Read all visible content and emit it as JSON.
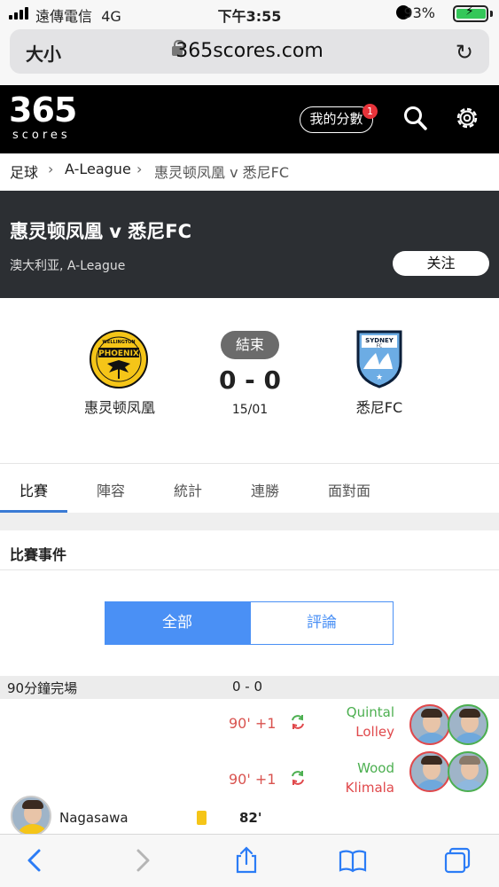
{
  "status_bar": {
    "carrier": "遠傳電信",
    "network": "4G",
    "time": "下午3:55",
    "battery": "93%"
  },
  "browser": {
    "text_size": "大小",
    "url": "365scores.com"
  },
  "site": {
    "logo_number": "365",
    "logo_word": "scores",
    "my_scores": "我的分數",
    "my_scores_badge": "1"
  },
  "breadcrumb": [
    "足球",
    "A-League",
    "惠灵顿凤凰 v 悉尼FC"
  ],
  "match": {
    "title": "惠灵顿凤凰 v 悉尼FC",
    "subtitle": "澳大利亚, A-League",
    "follow_label": "关注",
    "status": "結束",
    "score": "0 - 0",
    "date": "15/01",
    "home": {
      "name": "惠灵顿凤凰",
      "badge_text": "PHOENIX",
      "badge_top": "WELLINGTON"
    },
    "away": {
      "name": "悉尼FC",
      "badge_text": "SYDNEY",
      "badge_sub": "FC"
    }
  },
  "tabs": [
    "比賽",
    "陣容",
    "統計",
    "連勝",
    "面對面"
  ],
  "events": {
    "title": "比賽事件",
    "filter_all": "全部",
    "filter_comments": "評論",
    "fulltime_label": "90分鐘完場",
    "fulltime_score": "0 - 0",
    "subs": [
      {
        "minute": "90' +1",
        "player_in": "Quintal",
        "player_out": "Lolley"
      },
      {
        "minute": "90' +1",
        "player_in": "Wood",
        "player_out": "Klimala"
      }
    ],
    "card": {
      "player": "Nagasawa",
      "minute": "82'"
    }
  },
  "colors": {
    "accent": "#4a90f5",
    "sub_in": "#4caf50",
    "sub_out": "#e0484b",
    "yellow_card": "#f5c518"
  }
}
